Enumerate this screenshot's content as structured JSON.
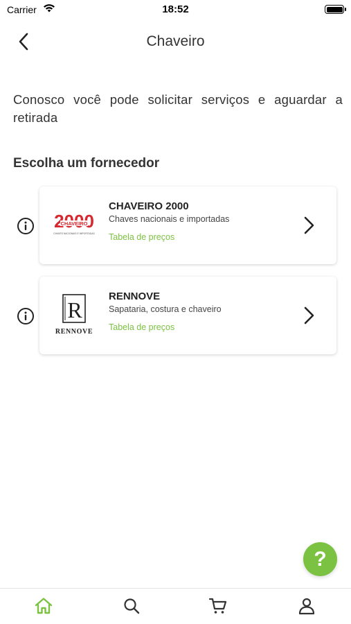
{
  "status_bar": {
    "carrier": "Carrier",
    "time": "18:52"
  },
  "nav": {
    "title": "Chaveiro",
    "back_icon": "chevron-left-icon"
  },
  "intro_text": "Conosco você pode solicitar serviços e aguardar a retirada",
  "section_title": "Escolha um fornecedor",
  "providers": [
    {
      "name": "CHAVEIRO 2000",
      "description": "Chaves nacionais e importadas",
      "link_label": "Tabela de preços",
      "logo": {
        "big": "2000",
        "small": "CHAVEIRO",
        "tag": "CHAVES NACIONAIS E IMPORTADAS",
        "color": "#d7282f"
      }
    },
    {
      "name": "RENNOVE",
      "description": "Sapataria, costura e chaveiro",
      "link_label": "Tabela de preços",
      "logo": {
        "letter": "R",
        "word": "RENNOVE",
        "color": "#222222"
      }
    }
  ],
  "help_fab": {
    "label": "?"
  },
  "tabs": [
    {
      "name": "home",
      "icon": "home-icon",
      "active": true
    },
    {
      "name": "search",
      "icon": "search-icon",
      "active": false
    },
    {
      "name": "cart",
      "icon": "cart-icon",
      "active": false
    },
    {
      "name": "profile",
      "icon": "user-icon",
      "active": false
    }
  ],
  "colors": {
    "accent": "#7cc242",
    "text": "#333333",
    "inactive_icon": "#333333"
  }
}
